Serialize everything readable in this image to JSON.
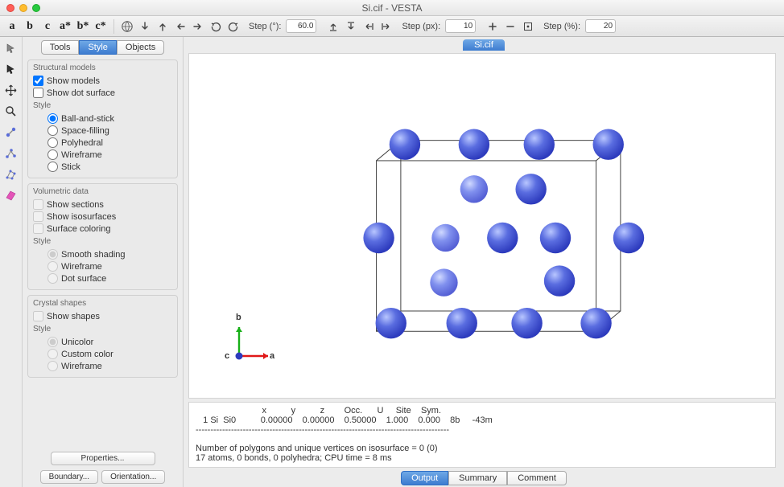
{
  "window": {
    "title": "Si.cif - VESTA"
  },
  "toolbar": {
    "axis_a": "a",
    "axis_b": "b",
    "axis_c": "c",
    "axis_as": "a*",
    "axis_bs": "b*",
    "axis_cs": "c*",
    "step_deg_label": "Step (°):",
    "step_deg_value": "60.0",
    "step_px_label": "Step (px):",
    "step_px_value": "10",
    "step_pct_label": "Step (%):",
    "step_pct_value": "20"
  },
  "side": {
    "tabs": {
      "tools": "Tools",
      "style": "Style",
      "objects": "Objects"
    },
    "structural": {
      "head": "Structural models",
      "show_models": "Show models",
      "show_dot": "Show dot surface",
      "style_label": "Style",
      "ball_stick": "Ball-and-stick",
      "space_filling": "Space-filling",
      "polyhedral": "Polyhedral",
      "wireframe": "Wireframe",
      "stick": "Stick"
    },
    "volumetric": {
      "head": "Volumetric data",
      "show_sections": "Show sections",
      "show_iso": "Show isosurfaces",
      "surface_color": "Surface coloring",
      "style_label": "Style",
      "smooth": "Smooth shading",
      "wireframe": "Wireframe",
      "dot": "Dot surface"
    },
    "crystal": {
      "head": "Crystal shapes",
      "show_shapes": "Show shapes",
      "style_label": "Style",
      "unicolor": "Unicolor",
      "custom": "Custom color",
      "wireframe": "Wireframe"
    },
    "buttons": {
      "properties": "Properties...",
      "boundary": "Boundary...",
      "orientation": "Orientation..."
    }
  },
  "view": {
    "filetab": "Si.cif",
    "axis_a": "a",
    "axis_b": "b",
    "axis_c": "c"
  },
  "console": {
    "line1": "                           x          y          z        Occ.      U     Site    Sym.",
    "line2": "   1 Si  Si0          0.00000    0.00000    0.50000    1.000    0.000    8b     -43m",
    "line3": "--------------------------------------------------------------------------------------",
    "line4": "Number of polygons and unique vertices on isosurface = 0 (0)",
    "line5": "17 atoms, 0 bonds, 0 polyhedra; CPU time = 8 ms"
  },
  "bottom_tabs": {
    "output": "Output",
    "summary": "Summary",
    "comment": "Comment"
  }
}
